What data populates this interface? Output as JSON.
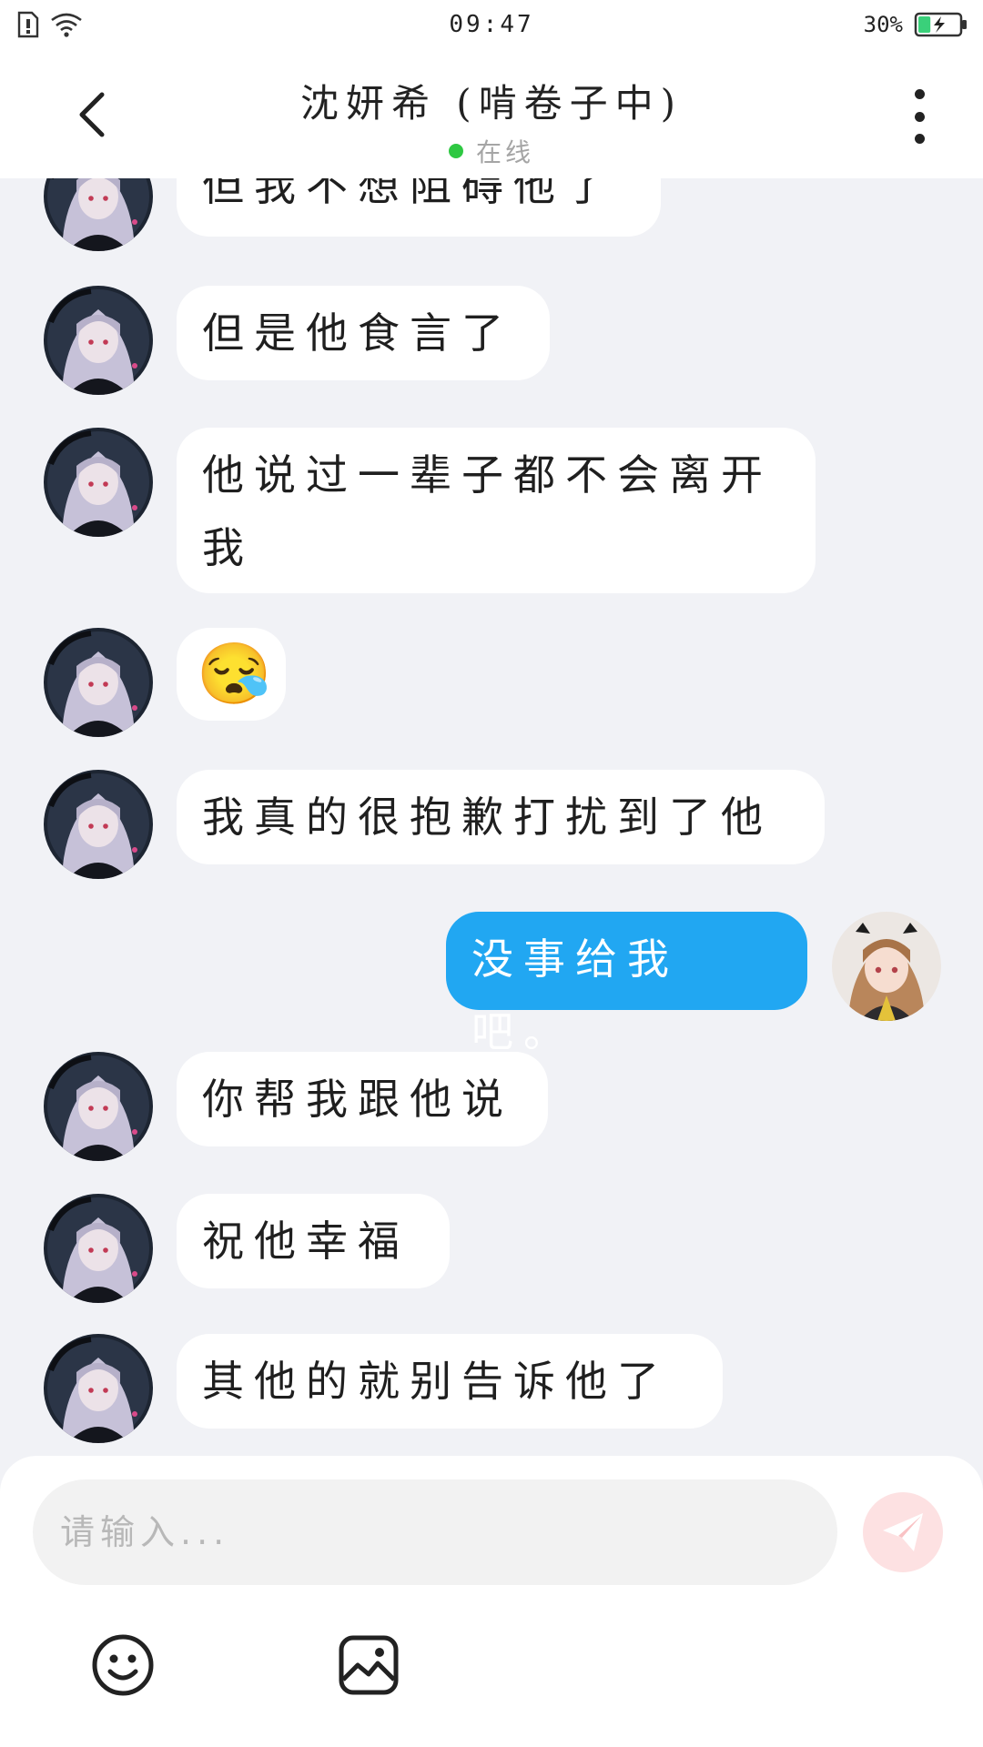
{
  "status_bar": {
    "time": "09:47",
    "battery_percent": "30%",
    "battery_level": 0.3,
    "icons": [
      "sim-card-icon",
      "wifi-icon",
      "battery-icon"
    ]
  },
  "header": {
    "title": "沈妍希 (啃卷子中)",
    "status": "在线",
    "status_color": "#2ec842"
  },
  "messages": [
    {
      "from": "other",
      "text": "但我不想阻碍他了"
    },
    {
      "from": "other",
      "text": "但是他食言了"
    },
    {
      "from": "other",
      "text": "他说过一辈子都不会离开\n我"
    },
    {
      "from": "other",
      "text": "😪"
    },
    {
      "from": "other",
      "text": "我真的很抱歉打扰到了他"
    },
    {
      "from": "self",
      "text": "没事给我吧。"
    },
    {
      "from": "other",
      "text": "你帮我跟他说"
    },
    {
      "from": "other",
      "text": "祝他幸福"
    },
    {
      "from": "other",
      "text": "其他的就别告诉他了"
    }
  ],
  "input": {
    "placeholder": "请输入..."
  },
  "colors": {
    "self_bubble": "#21a7f2",
    "other_bubble": "#ffffff",
    "chat_background": "#f1f2f6",
    "send_button": "#fde1e2"
  },
  "toolbar": {
    "icons": [
      "emoji-icon",
      "image-icon"
    ]
  }
}
